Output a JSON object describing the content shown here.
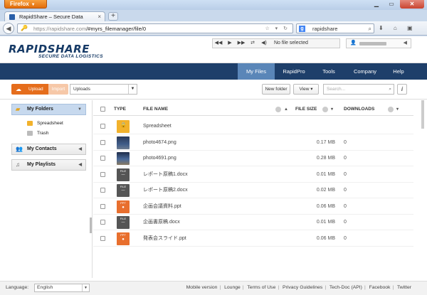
{
  "browser": {
    "app_button": "Firefox",
    "tab_title": "RapidShare – Secure Data Logistics",
    "new_tab": "+",
    "url_host": "https://rapidshare.com",
    "url_path": "/#myrs_filemanager/file/0",
    "search_value": "rapidshare",
    "search_engine_letter": "g"
  },
  "header": {
    "logo_main": "RAPIDSHARE",
    "logo_tagline": "SECURE DATA LOGISTICS",
    "player_status": "No file selected"
  },
  "nav": {
    "items": [
      "My Files",
      "RapidPro",
      "Tools",
      "Company",
      "Help"
    ],
    "active": "My Files"
  },
  "toolbar": {
    "upload": "Upload",
    "import": "Import",
    "uploads_select": "Uploads",
    "new_folder": "New folder",
    "view": "View",
    "search_placeholder": "Search..."
  },
  "sidebar": {
    "my_folders": "My Folders",
    "folders": [
      "Spreadsheet",
      "Trash"
    ],
    "my_contacts": "My Contacts",
    "my_playlists": "My Playlists"
  },
  "table": {
    "col_type": "TYPE",
    "col_name": "FILE NAME",
    "col_size": "FILE SIZE",
    "col_downloads": "DOWNLOADS",
    "rows": [
      {
        "type": "folder",
        "name": "Spreadsheet",
        "size": "",
        "downloads": ""
      },
      {
        "type": "photo1",
        "name": "photo4674.png",
        "size": "0.17 MB",
        "downloads": "0"
      },
      {
        "type": "photo2",
        "name": "photo4691.png",
        "size": "0.28 MB",
        "downloads": "0"
      },
      {
        "type": "doc",
        "name": "レポート原稿1.docx",
        "size": "0.01 MB",
        "downloads": "0"
      },
      {
        "type": "doc",
        "name": "レポート原稿2.docx",
        "size": "0.02 MB",
        "downloads": "0"
      },
      {
        "type": "ppt",
        "name": "企画会議資料.ppt",
        "size": "0.06 MB",
        "downloads": "0"
      },
      {
        "type": "doc",
        "name": "企画書原稿.docx",
        "size": "0.01 MB",
        "downloads": "0"
      },
      {
        "type": "ppt",
        "name": "発表会スライド.ppt",
        "size": "0.06 MB",
        "downloads": "0"
      }
    ],
    "doc_label": "FILE",
    "ppt_label": "PPT"
  },
  "footer": {
    "language_label": "Language:",
    "language_value": "English",
    "links": [
      "Mobile version",
      "Lounge",
      "Terms of Use",
      "Privacy Guidelines",
      "Tech-Doc (API)",
      "Facebook",
      "Twitter"
    ]
  },
  "colors": {
    "nav_bg": "#1e3f6a",
    "nav_active": "#5a86b8",
    "upload": "#e56d1c",
    "folder": "#f2b22c",
    "ppt": "#e86f2e"
  }
}
